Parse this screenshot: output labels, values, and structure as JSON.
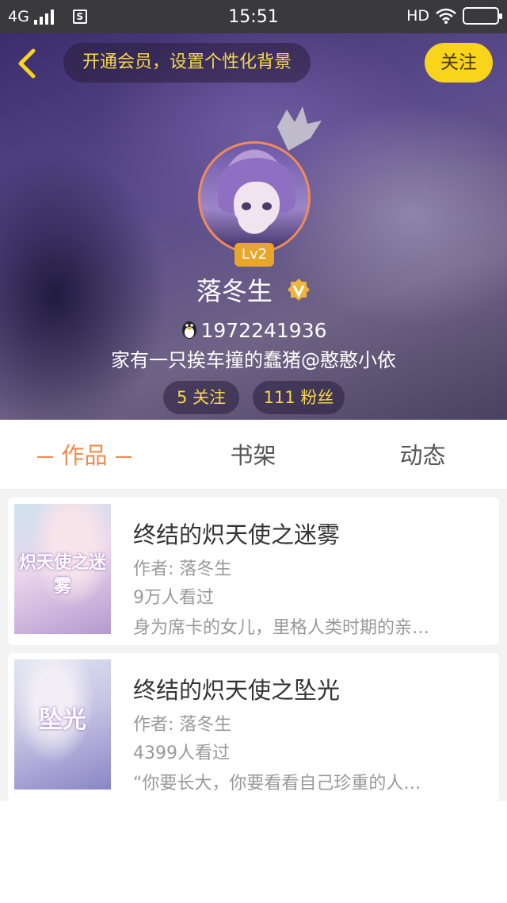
{
  "status_bar": {
    "network": "4G",
    "sim_label": "S",
    "time": "15:51",
    "hd_label": "HD"
  },
  "header": {
    "vip_prompt": "开通会员，设置个性化背景",
    "follow_label": "关注",
    "level": "Lv2",
    "username": "落冬生",
    "qq_number": "1972241936",
    "bio": "家有一只挨车撞的蠢猪@憨憨小依",
    "following_label": "5 关注",
    "followers_label": "111 粉丝"
  },
  "tabs": [
    {
      "label": "作品",
      "active": true
    },
    {
      "label": "书架",
      "active": false
    },
    {
      "label": "动态",
      "active": false
    }
  ],
  "books": [
    {
      "title": "终结的炽天使之迷雾",
      "author": "作者: 落冬生",
      "reads": "9万人看过",
      "description": "身为席卡的女儿，里格人类时期的亲…",
      "cover_text": "炽天使之迷雾"
    },
    {
      "title": "终结的炽天使之坠光",
      "author": "作者: 落冬生",
      "reads": "4399人看过",
      "description": "“你要长大，你要看看自己珍重的人…",
      "cover_text": "坠光"
    }
  ],
  "colors": {
    "accent": "#f28a4e",
    "follow_button": "#f8d41a",
    "pill_text": "#f8d74c"
  }
}
